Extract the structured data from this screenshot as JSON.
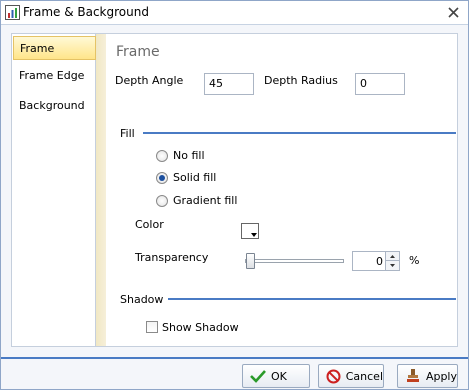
{
  "window": {
    "title": "Frame & Background",
    "close_glyph": "✕"
  },
  "nav": {
    "items": [
      {
        "label": "Frame",
        "selected": true
      },
      {
        "label": "Frame Edge",
        "selected": false
      },
      {
        "label": "Background",
        "selected": false
      }
    ]
  },
  "frame": {
    "heading": "Frame",
    "depth_angle_label": "Depth Angle",
    "depth_angle_value": "45",
    "depth_radius_label": "Depth Radius",
    "depth_radius_value": "0"
  },
  "fill": {
    "section_label": "Fill",
    "options": [
      {
        "label": "No fill",
        "checked": false
      },
      {
        "label": "Solid fill",
        "checked": true
      },
      {
        "label": "Gradient fill",
        "checked": false
      }
    ],
    "color_label": "Color",
    "color_value": "#ffffff",
    "transparency_label": "Transparency",
    "transparency_value": "0",
    "transparency_unit": "%"
  },
  "shadow": {
    "section_label": "Shadow",
    "show_shadow_label": "Show Shadow",
    "show_shadow_checked": false
  },
  "buttons": {
    "ok": "OK",
    "cancel": "Cancel",
    "apply": "Apply"
  },
  "colors": {
    "accent": "#4a7bc4",
    "nav_selected": "#ffe58a"
  }
}
